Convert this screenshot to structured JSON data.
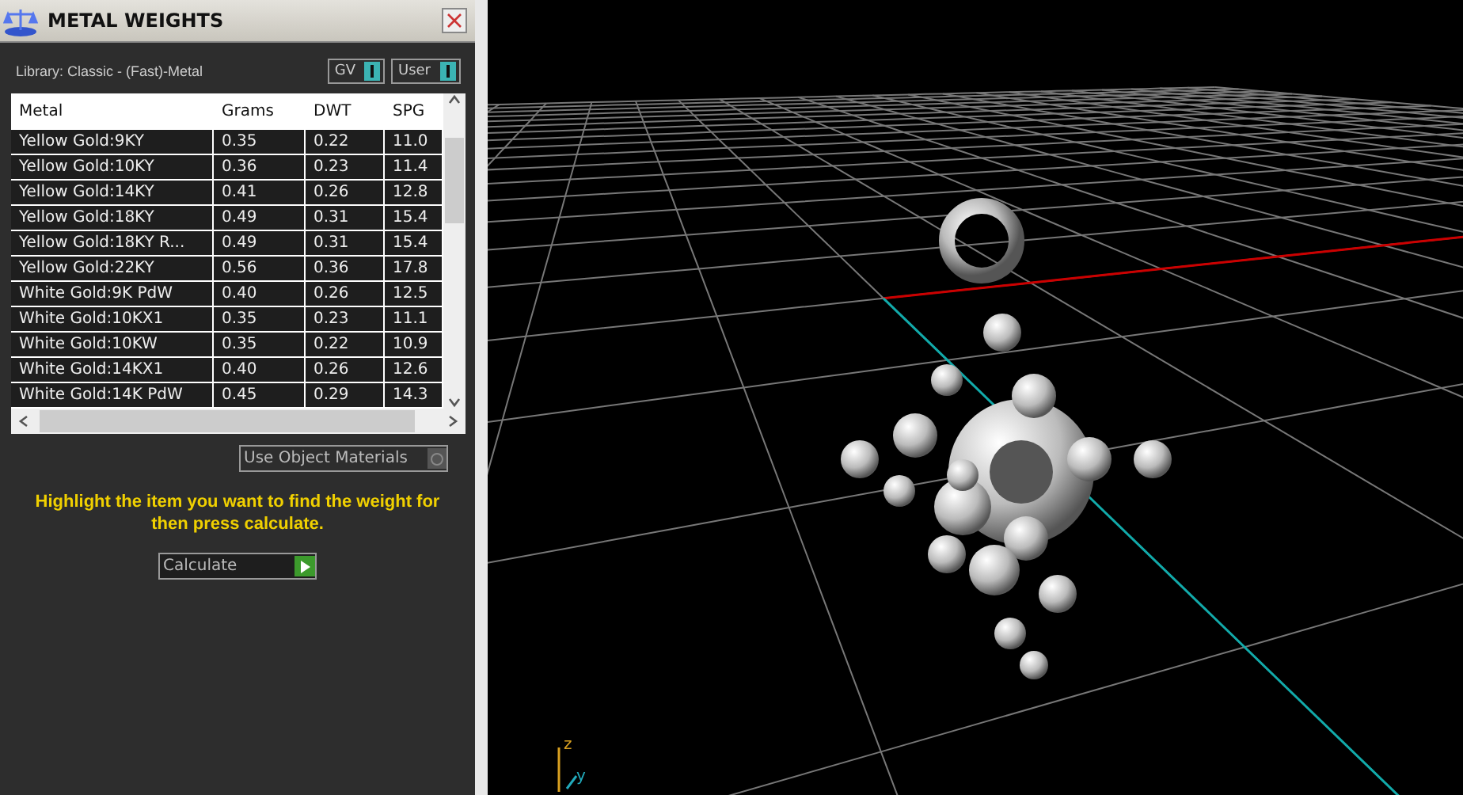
{
  "panel": {
    "title": "METAL WEIGHTS",
    "library": "Library: Classic - (Fast)-Metal",
    "toggles": [
      {
        "label": "GV",
        "on": true
      },
      {
        "label": "User",
        "on": true
      }
    ],
    "table": {
      "columns": [
        "Metal",
        "Grams",
        "DWT",
        "SPG"
      ],
      "rows": [
        [
          "Yellow Gold:9KY",
          "0.35",
          "0.22",
          "11.0"
        ],
        [
          "Yellow Gold:10KY",
          "0.36",
          "0.23",
          "11.4"
        ],
        [
          "Yellow Gold:14KY",
          "0.41",
          "0.26",
          "12.8"
        ],
        [
          "Yellow Gold:18KY",
          "0.49",
          "0.31",
          "15.4"
        ],
        [
          "Yellow Gold:18KY R...",
          "0.49",
          "0.31",
          "15.4"
        ],
        [
          "Yellow Gold:22KY",
          "0.56",
          "0.36",
          "17.8"
        ],
        [
          "White Gold:9K PdW",
          "0.40",
          "0.26",
          "12.5"
        ],
        [
          "White Gold:10KX1",
          "0.35",
          "0.23",
          "11.1"
        ],
        [
          "White Gold:10KW",
          "0.35",
          "0.22",
          "10.9"
        ],
        [
          "White Gold:14KX1",
          "0.40",
          "0.26",
          "12.6"
        ],
        [
          "White Gold:14K PdW",
          "0.45",
          "0.29",
          "14.3"
        ]
      ]
    },
    "use_object_materials": {
      "label": "Use Object Materials",
      "checked": false
    },
    "hint": "Highlight the item you want to find the weight for then press calculate.",
    "calculate_button": "Calculate"
  },
  "viewport": {
    "axis_labels": [
      "z",
      "y"
    ]
  }
}
